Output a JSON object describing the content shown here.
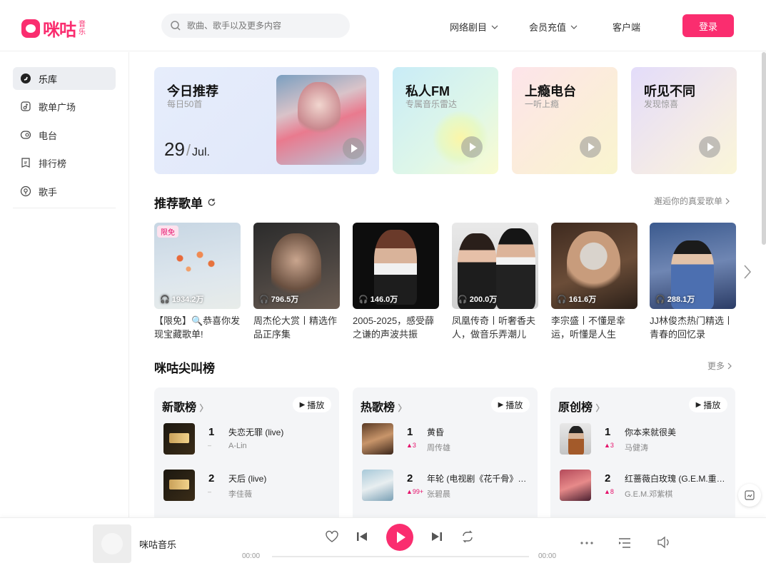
{
  "app": {
    "logo_text": "咪咕",
    "logo_sub": "音乐",
    "brand_color": "#fa2d6f"
  },
  "search": {
    "placeholder": "歌曲、歌手以及更多内容"
  },
  "header_nav": [
    {
      "label": "网络剧目",
      "has_dropdown": true
    },
    {
      "label": "会员充值",
      "has_dropdown": true
    },
    {
      "label": "客户端",
      "has_dropdown": false
    }
  ],
  "login_label": "登录",
  "sidebar": {
    "items": [
      {
        "label": "乐库",
        "icon": "music-disc-icon",
        "active": true
      },
      {
        "label": "歌单广场",
        "icon": "playlist-icon",
        "active": false
      },
      {
        "label": "电台",
        "icon": "radio-icon",
        "active": false
      },
      {
        "label": "排行榜",
        "icon": "chart-rank-icon",
        "active": false
      },
      {
        "label": "歌手",
        "icon": "singer-icon",
        "active": false
      }
    ]
  },
  "hero": {
    "daily": {
      "title": "今日推荐",
      "subtitle": "每日50首",
      "day": "29",
      "month": "Jul."
    },
    "fm": {
      "title": "私人FM",
      "subtitle": "专属音乐雷达"
    },
    "radio": {
      "title": "上瘾电台",
      "subtitle": "一听上瘾"
    },
    "discover": {
      "title": "听见不同",
      "subtitle": "发现惊喜"
    }
  },
  "playlists_section": {
    "title": "推荐歌单",
    "more": "邂逅你的真爱歌单",
    "items": [
      {
        "name": "【限免】🔍恭喜你发现宝藏歌单!",
        "count": "1934.2万",
        "badge": "限免"
      },
      {
        "name": "周杰伦大赏丨精选作品正序集",
        "count": "796.5万",
        "badge": ""
      },
      {
        "name": "2005-2025，感受薛之谦的声波共振",
        "count": "146.0万",
        "badge": ""
      },
      {
        "name": "凤凰传奇丨听奢香夫人，做音乐弄潮儿",
        "count": "200.0万",
        "badge": ""
      },
      {
        "name": "李宗盛丨不懂是幸运，听懂是人生",
        "count": "161.6万",
        "badge": ""
      },
      {
        "name": "JJ林俊杰热门精选丨青春的回忆录",
        "count": "288.1万",
        "badge": ""
      }
    ]
  },
  "charts_section": {
    "title": "咪咕尖叫榜",
    "more": "更多",
    "play_label": "播放",
    "charts": [
      {
        "title": "新歌榜",
        "songs": [
          {
            "rank": "1",
            "name": "失恋无罪 (live)",
            "artist": "A-Lin",
            "trend": "–"
          },
          {
            "rank": "2",
            "name": "天后 (live)",
            "artist": "李佳薇",
            "trend": "–"
          }
        ]
      },
      {
        "title": "热歌榜",
        "songs": [
          {
            "rank": "1",
            "name": "黄昏",
            "artist": "周传雄",
            "trend": "▲3"
          },
          {
            "rank": "2",
            "name": "年轮 (电视剧《花千骨》…",
            "artist": "张碧晨",
            "trend": "▲99+"
          }
        ]
      },
      {
        "title": "原创榜",
        "songs": [
          {
            "rank": "1",
            "name": "你本来就很美",
            "artist": "马健涛",
            "trend": "▲3"
          },
          {
            "rank": "2",
            "name": "红蔷薇白玫瑰 (G.E.M.重…",
            "artist": "G.E.M.邓紫棋",
            "trend": "▲8"
          }
        ]
      }
    ]
  },
  "player": {
    "title": "咪咕音乐",
    "time_current": "00:00",
    "time_total": "00:00",
    "progress": 0
  }
}
